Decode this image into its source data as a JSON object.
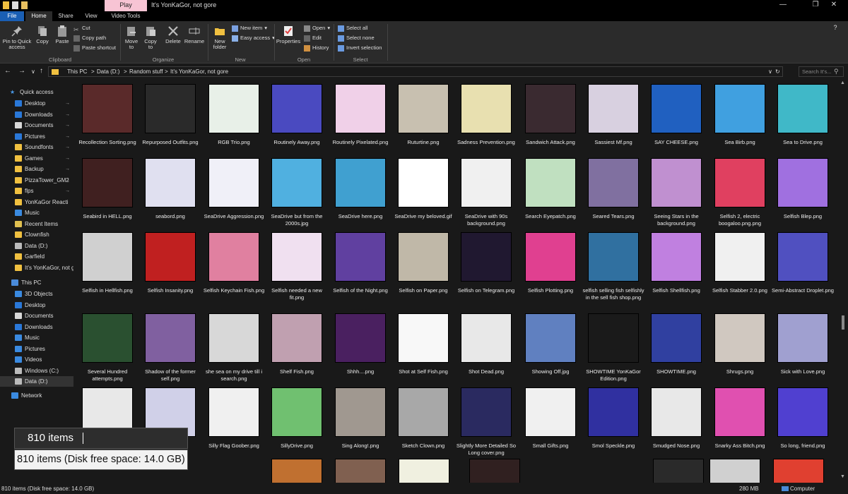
{
  "window": {
    "title": "It's YonKaGor, not gore",
    "context_tab": "Play"
  },
  "tabs": [
    "File",
    "Home",
    "Share",
    "View",
    "Video Tools"
  ],
  "ribbon": {
    "clipboard": {
      "label": "Clipboard",
      "pin": "Pin to Quick access",
      "copy": "Copy",
      "paste": "Paste",
      "cut": "Cut",
      "copy_path": "Copy path",
      "paste_shortcut": "Paste shortcut"
    },
    "organize": {
      "label": "Organize",
      "move_to": "Move to",
      "copy_to": "Copy to",
      "delete": "Delete",
      "rename": "Rename"
    },
    "new": {
      "label": "New",
      "new_folder": "New folder",
      "new_item": "New item",
      "easy_access": "Easy access"
    },
    "open": {
      "label": "Open",
      "properties": "Properties",
      "open": "Open",
      "edit": "Edit",
      "history": "History"
    },
    "select": {
      "label": "Select",
      "select_all": "Select all",
      "select_none": "Select none",
      "invert": "Invert selection"
    }
  },
  "address": {
    "crumbs": [
      "This PC",
      "Data (D:)",
      "Random stuff",
      "It's YonKaGor, not gore"
    ],
    "search_placeholder": "Search It's..."
  },
  "sidebar": {
    "quick_access": "Quick access",
    "quick_items": [
      "Desktop",
      "Downloads",
      "Documents",
      "Pictures",
      "Soundfonts",
      "Games",
      "Backup",
      "PizzaTower_GM2",
      "flps",
      "YonKaGor Reacti",
      "Music",
      "Recent Items",
      "Clownfish",
      "Data (D:)",
      "Garfield",
      "It's YonKaGor, not g"
    ],
    "this_pc": "This PC",
    "pc_items": [
      "3D Objects",
      "Desktop",
      "Documents",
      "Downloads",
      "Music",
      "Pictures",
      "Videos",
      "Windows (C:)",
      "Data (D:)"
    ],
    "network": "Network"
  },
  "files": [
    [
      "Recollection Sorting.png",
      "Repurposed Outfits.png",
      "RGB Trio.png",
      "Routinely Away.png",
      "Routinely Pixelated.png",
      "Ruturtine.png",
      "Sadness Prevention.png",
      "Sandwich Attack.png",
      "Sassiest Mf.png",
      "SAY CHEESE.png",
      "Sea Birb.png",
      "Sea to Drive.png"
    ],
    [
      "Seabird in HELL.png",
      "seabord.png",
      "SeaDrive Aggression.png",
      "SeaDrive but from the 2000s.jpg",
      "SeaDrive here.png",
      "SeaDrive my beloved.gif",
      "SeaDrive with 90s background.png",
      "Search Eyepatch.png",
      "Seared Tears.png",
      "Seeing Stars in the background.png",
      "Selfish 2, electric boogaloo.png.png",
      "Selfish Blep.png"
    ],
    [
      "Selfish in Hellfish.png",
      "Selfish Insanity.png",
      "Selfish Keychain Fish.png",
      "Selfish needed a new fit.png",
      "Selfish of the Night.png",
      "Selfish on Paper.png",
      "Selfish on Telegram.png",
      "Selfish Plotting.png",
      "selfish selling fish selfishly in the sell fish shop.png",
      "Selfish Shellfish.png",
      "Selfish Stabber 2.0.png",
      "Semi-Abstract Droplet.png"
    ],
    [
      "Several Hundred attempts.png",
      "Shadow of the former self.png",
      "she sea on my drive till i search.png",
      "Shelf Fish.png",
      "Shhh....png",
      "Shot at Self Fish.png",
      "Shot Dead.png",
      "Showing Off.jpg",
      "SHOWTIME YonKaGor Edition.png",
      "SHOWTIME.png",
      "Shrugs.png",
      "Sick with Love.png"
    ],
    [
      "",
      "",
      "Silly Flag Goober.png",
      "SillyDrive.png",
      "Sing Along!.png",
      "Sketch Clown.png",
      "Slightly More Detailed So Long cover.png",
      "Small Gifts.png",
      "Smol Speckle.png",
      "Smudged Nose.png",
      "Snarky Ass Bitch.png",
      "So long, friend.png"
    ]
  ],
  "thumb_colors": [
    [
      "#5a2a2a",
      "#2a2a2a",
      "#e8f0e8",
      "#4a4ac0",
      "#f0d0e8",
      "#c8c0b0",
      "#e8e0b0",
      "#3a2a30",
      "#d8d0e0",
      "#2060c0",
      "#40a0e0",
      "#40b8c8"
    ],
    [
      "#402020",
      "#e0e0f0",
      "#f0f0f8",
      "#50b0e0",
      "#40a0d0",
      "#ffffff",
      "#f0f0f0",
      "#c0e0c0",
      "#8070a0",
      "#c090d0",
      "#e04060",
      "#a070e0"
    ],
    [
      "#d0d0d0",
      "#c02020",
      "#e080a0",
      "#f0e0f0",
      "#6040a0",
      "#c0b8a8",
      "#201830",
      "#e04090",
      "#3070a0",
      "#c080e0",
      "#f0f0f0",
      "#5050c0"
    ],
    [
      "#2a5030",
      "#8060a0",
      "#d8d8d8",
      "#c0a0b0",
      "#4a2060",
      "#f8f8f8",
      "#e8e8e8",
      "#6080c0",
      "#1a1a1a",
      "#3040a0",
      "#d0c8c0",
      "#a0a0d0"
    ],
    [
      "#e8e8e8",
      "#d0d0e8",
      "#f0f0f0",
      "#70c070",
      "#a09890",
      "#a8a8a8",
      "#2a2a60",
      "#f0f0f0",
      "#3030a0",
      "#e8e8e8",
      "#e050b0",
      "#5040d0"
    ]
  ],
  "row6_colors": [
    "#c07030",
    "#806050",
    "#f0f0e0",
    "#302020",
    "#2a2a2a",
    "#d0d0d0",
    "#e04030",
    "#f8f8f8",
    "#f0d0d0",
    "#5090c0"
  ],
  "status": {
    "items": "810 items (Disk free space: 14.0 GB)",
    "size": "280 MB",
    "computer": "Computer"
  },
  "tooltip": {
    "count": "810 items",
    "detail": "810 items (Disk free space: 14.0 GB)"
  }
}
